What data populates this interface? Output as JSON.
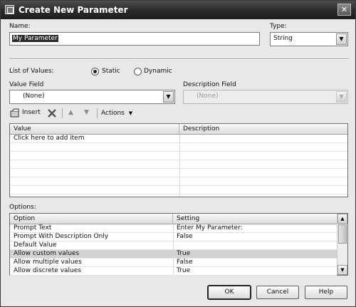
{
  "window": {
    "title": "Create New Parameter",
    "close_glyph": "✕"
  },
  "name": {
    "label": "Name:",
    "value": "My Parameter"
  },
  "type": {
    "label": "Type:",
    "value": "String"
  },
  "list_of_values": {
    "label": "List of Values:",
    "static_label": "Static",
    "dynamic_label": "Dynamic",
    "selected": "Static"
  },
  "value_field": {
    "label": "Value Field",
    "value": "(None)"
  },
  "description_field": {
    "label": "Description Field",
    "value": "(None)"
  },
  "toolbar": {
    "insert_label": "Insert",
    "actions_label": "Actions"
  },
  "values_table": {
    "columns": [
      "Value",
      "Description"
    ],
    "rows": [
      [
        "Click here to add item",
        ""
      ],
      [
        "",
        ""
      ],
      [
        "",
        ""
      ],
      [
        "",
        ""
      ],
      [
        "",
        ""
      ],
      [
        "",
        ""
      ],
      [
        "",
        ""
      ]
    ]
  },
  "options": {
    "label": "Options:",
    "columns": [
      "Option",
      "Setting"
    ],
    "rows": [
      [
        "Prompt Text",
        "Enter My Parameter:"
      ],
      [
        "Prompt With Description Only",
        "False"
      ],
      [
        "Default Value",
        ""
      ],
      [
        "Allow custom values",
        "True"
      ],
      [
        "Allow multiple values",
        "False"
      ],
      [
        "Allow discrete values",
        "True"
      ]
    ],
    "highlighted_row": 3
  },
  "buttons": {
    "ok": "OK",
    "cancel": "Cancel",
    "help": "Help"
  },
  "icons": {
    "insert": "insert-icon",
    "delete": "delete-icon",
    "move_up": "arrow-up-icon",
    "move_down": "arrow-down-icon",
    "dropdown": "chevron-down-icon"
  }
}
